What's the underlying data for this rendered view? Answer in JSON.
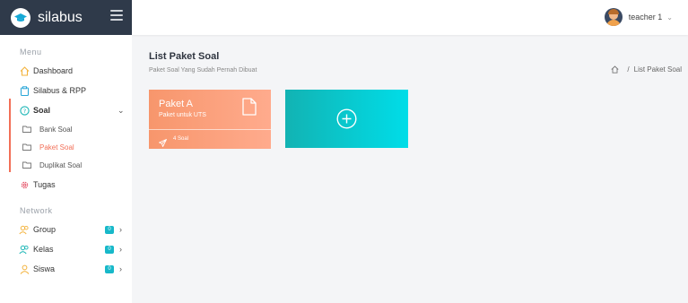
{
  "brand": {
    "name": "silabus"
  },
  "user": {
    "name": "teacher 1"
  },
  "sidebar": {
    "menu_label": "Menu",
    "network_label": "Network",
    "items": [
      {
        "label": "Dashboard"
      },
      {
        "label": "Silabus & RPP"
      },
      {
        "label": "Soal"
      },
      {
        "label": "Tugas"
      },
      {
        "label": "Group",
        "badge": "0"
      },
      {
        "label": "Kelas",
        "badge": "0"
      },
      {
        "label": "Siswa",
        "badge": "0"
      }
    ],
    "subitems": [
      {
        "label": "Bank Soal"
      },
      {
        "label": "Paket Soal"
      },
      {
        "label": "Duplikat Soal"
      }
    ]
  },
  "page": {
    "title": "List Paket Soal",
    "subtitle": "Paket Soal Yang Sudah Pernah Dibuat"
  },
  "breadcrumb": {
    "separator": "/",
    "current": "List Paket Soal"
  },
  "cards": [
    {
      "title": "Paket A",
      "desc": "Paket untuk UTS",
      "count": "4 Soal"
    }
  ],
  "colors": {
    "accent": "#f26f57",
    "sidebar_header": "#2f3a4a",
    "badge": "#17b8c9",
    "card_orange": "#f7966c",
    "card_cyan": "#00dde8"
  },
  "icons": {
    "brand": "graduation-cap-icon",
    "menu": "hamburger-icon",
    "home": "home-icon",
    "file": "file-icon",
    "send": "paper-plane-icon",
    "add": "plus-circle-icon"
  }
}
